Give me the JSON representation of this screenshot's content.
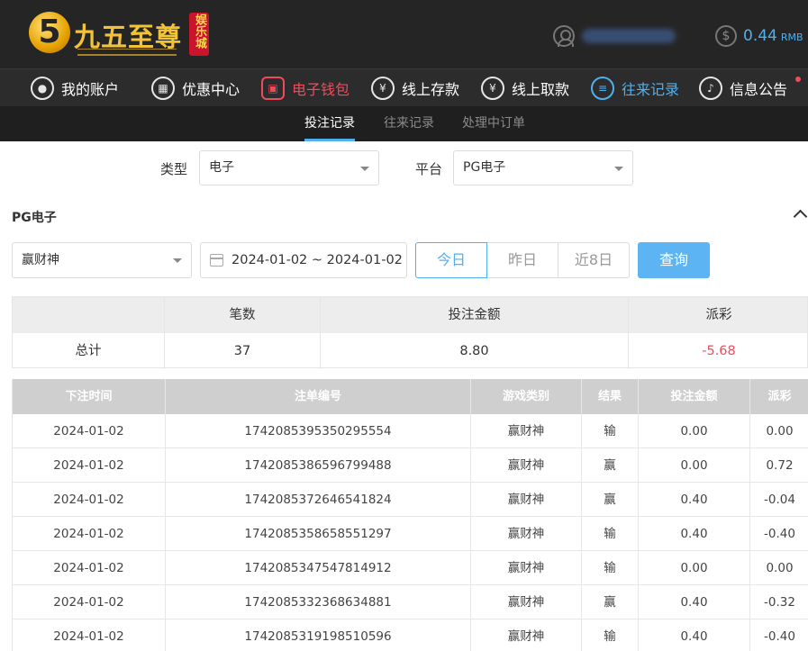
{
  "header": {
    "logo_numeral": "5",
    "logo_text": "九五至尊",
    "logo_badge": "娱乐城",
    "balance": "0.44",
    "currency": "RMB",
    "coin_symbol": "$"
  },
  "nav": {
    "items": [
      {
        "label": "我的账户",
        "icon": "user-icon"
      },
      {
        "label": "优惠中心",
        "icon": "gift-icon"
      },
      {
        "label": "电子钱包",
        "icon": "wallet-icon"
      },
      {
        "label": "线上存款",
        "icon": "deposit-icon"
      },
      {
        "label": "线上取款",
        "icon": "withdraw-icon"
      },
      {
        "label": "往来记录",
        "icon": "records-icon"
      },
      {
        "label": "信息公告",
        "icon": "bell-icon"
      }
    ]
  },
  "subtabs": [
    "投注记录",
    "往来记录",
    "处理中订单"
  ],
  "filters": {
    "type_label": "类型",
    "type_value": "电子",
    "platform_label": "平台",
    "platform_value": "PG电子"
  },
  "section": {
    "title": "PG电子",
    "game_value": "赢财神",
    "date_range": "2024-01-02 ~ 2024-01-02",
    "range_buttons": [
      "今日",
      "昨日",
      "近8日"
    ],
    "query_label": "查询"
  },
  "summary": {
    "headers": [
      "",
      "笔数",
      "投注金额",
      "派彩"
    ],
    "row_label": "总计",
    "count": "37",
    "bet_amount": "8.80",
    "payout": "-5.68"
  },
  "table": {
    "headers": [
      "下注时间",
      "注单编号",
      "游戏类别",
      "结果",
      "投注金额",
      "派彩"
    ],
    "rows": [
      {
        "time": "2024-01-02",
        "id": "1742085395350295554",
        "game": "赢财神",
        "result": "输",
        "bet": "0.00",
        "payout": "0.00"
      },
      {
        "time": "2024-01-02",
        "id": "1742085386596799488",
        "game": "赢财神",
        "result": "赢",
        "bet": "0.00",
        "payout": "0.72"
      },
      {
        "time": "2024-01-02",
        "id": "1742085372646541824",
        "game": "赢财神",
        "result": "赢",
        "bet": "0.40",
        "payout": "-0.04"
      },
      {
        "time": "2024-01-02",
        "id": "1742085358658551297",
        "game": "赢财神",
        "result": "输",
        "bet": "0.40",
        "payout": "-0.40"
      },
      {
        "time": "2024-01-02",
        "id": "1742085347547814912",
        "game": "赢财神",
        "result": "输",
        "bet": "0.00",
        "payout": "0.00"
      },
      {
        "time": "2024-01-02",
        "id": "1742085332368634881",
        "game": "赢财神",
        "result": "赢",
        "bet": "0.40",
        "payout": "-0.32"
      },
      {
        "time": "2024-01-02",
        "id": "1742085319198510596",
        "game": "赢财神",
        "result": "输",
        "bet": "0.40",
        "payout": "-0.40"
      }
    ]
  },
  "colors": {
    "accent_blue": "#4fb0f0",
    "accent_red": "#f04b5c",
    "header_bg": "#252525",
    "gold": "#f2c335"
  }
}
